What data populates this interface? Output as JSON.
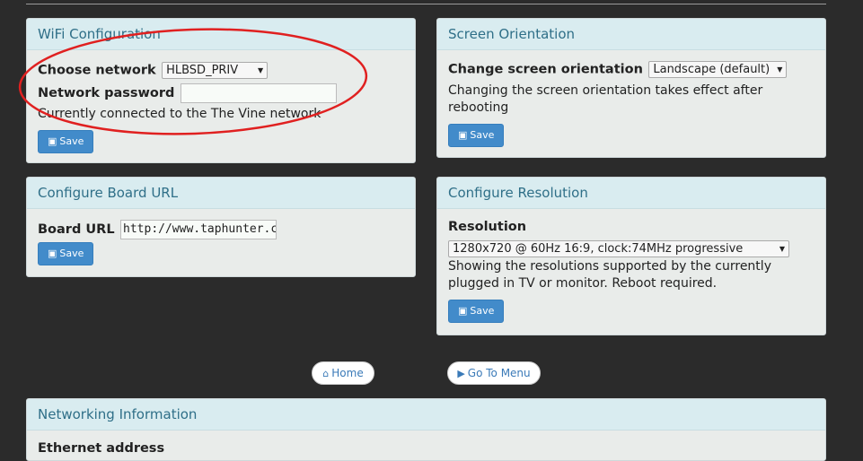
{
  "wifi": {
    "title": "WiFi Configuration",
    "choose_label": "Choose network",
    "network_selected": "HLBSD_PRIV",
    "password_label": "Network password",
    "password_value": "",
    "connected_text": "Currently connected to the The Vine network",
    "save_label": "Save"
  },
  "orientation": {
    "title": "Screen Orientation",
    "change_label": "Change screen orientation",
    "selected": "Landscape (default)",
    "note": "Changing the screen orientation takes effect after rebooting",
    "save_label": "Save"
  },
  "board": {
    "title": "Configure Board URL",
    "url_label": "Board URL",
    "url_value": "http://www.taphunter.co",
    "save_label": "Save"
  },
  "resolution": {
    "title": "Configure Resolution",
    "label": "Resolution",
    "selected": "1280x720 @ 60Hz 16:9, clock:74MHz progressive",
    "note": "Showing the resolutions supported by the currently plugged in TV or monitor. Reboot required.",
    "save_label": "Save"
  },
  "nav": {
    "home_label": "Home",
    "menu_label": "Go To Menu"
  },
  "networking": {
    "title": "Networking Information",
    "partial_label": "Ethernet address"
  },
  "icons": {
    "save": "floppy-disk-icon",
    "home": "home-icon",
    "menu": "play-icon",
    "dropdown": "caret-down-icon"
  },
  "colors": {
    "background": "#2b2b2b",
    "panel_header": "#d9ecf0",
    "panel_body": "#e9ecea",
    "header_text": "#2f6f88",
    "button": "#428bca",
    "annotation": "#e02020"
  }
}
